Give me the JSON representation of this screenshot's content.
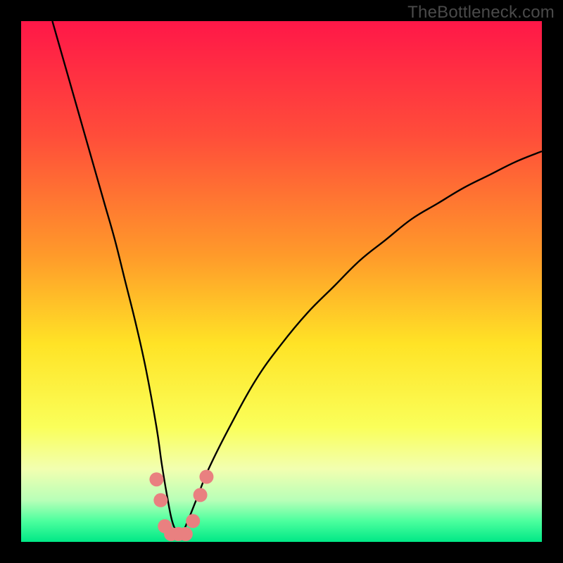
{
  "watermark": "TheBottleneck.com",
  "chart_data": {
    "type": "line",
    "title": "",
    "xlabel": "",
    "ylabel": "",
    "xlim": [
      0,
      100
    ],
    "ylim": [
      0,
      100
    ],
    "grid": false,
    "legend": false,
    "background_gradient": {
      "stops": [
        {
          "offset": 0.0,
          "color": "#ff1748"
        },
        {
          "offset": 0.22,
          "color": "#ff4d3a"
        },
        {
          "offset": 0.45,
          "color": "#ff9a2a"
        },
        {
          "offset": 0.62,
          "color": "#ffe326"
        },
        {
          "offset": 0.78,
          "color": "#faff5a"
        },
        {
          "offset": 0.86,
          "color": "#f2ffb0"
        },
        {
          "offset": 0.92,
          "color": "#b8ffb8"
        },
        {
          "offset": 0.96,
          "color": "#4cff9e"
        },
        {
          "offset": 1.0,
          "color": "#00e886"
        }
      ]
    },
    "series": [
      {
        "name": "bottleneck-curve",
        "x": [
          6,
          8,
          10,
          12,
          14,
          16,
          18,
          20,
          22,
          24,
          26,
          27,
          28,
          29,
          30,
          31,
          32,
          34,
          36,
          40,
          45,
          50,
          55,
          60,
          65,
          70,
          75,
          80,
          85,
          90,
          95,
          100
        ],
        "y": [
          100,
          93,
          86,
          79,
          72,
          65,
          58,
          50,
          42,
          33,
          22,
          15,
          9,
          4,
          2,
          2,
          4,
          9,
          14,
          22,
          31,
          38,
          44,
          49,
          54,
          58,
          62,
          65,
          68,
          70.5,
          73,
          75
        ]
      }
    ],
    "markers": {
      "name": "highlight-dots",
      "color": "#e98080",
      "points": [
        {
          "x": 26.0,
          "y": 12
        },
        {
          "x": 26.8,
          "y": 8
        },
        {
          "x": 27.6,
          "y": 3
        },
        {
          "x": 28.8,
          "y": 1.5
        },
        {
          "x": 30.2,
          "y": 1.5
        },
        {
          "x": 31.6,
          "y": 1.5
        },
        {
          "x": 33.0,
          "y": 4
        },
        {
          "x": 34.4,
          "y": 9
        },
        {
          "x": 35.6,
          "y": 12.5
        }
      ]
    }
  }
}
